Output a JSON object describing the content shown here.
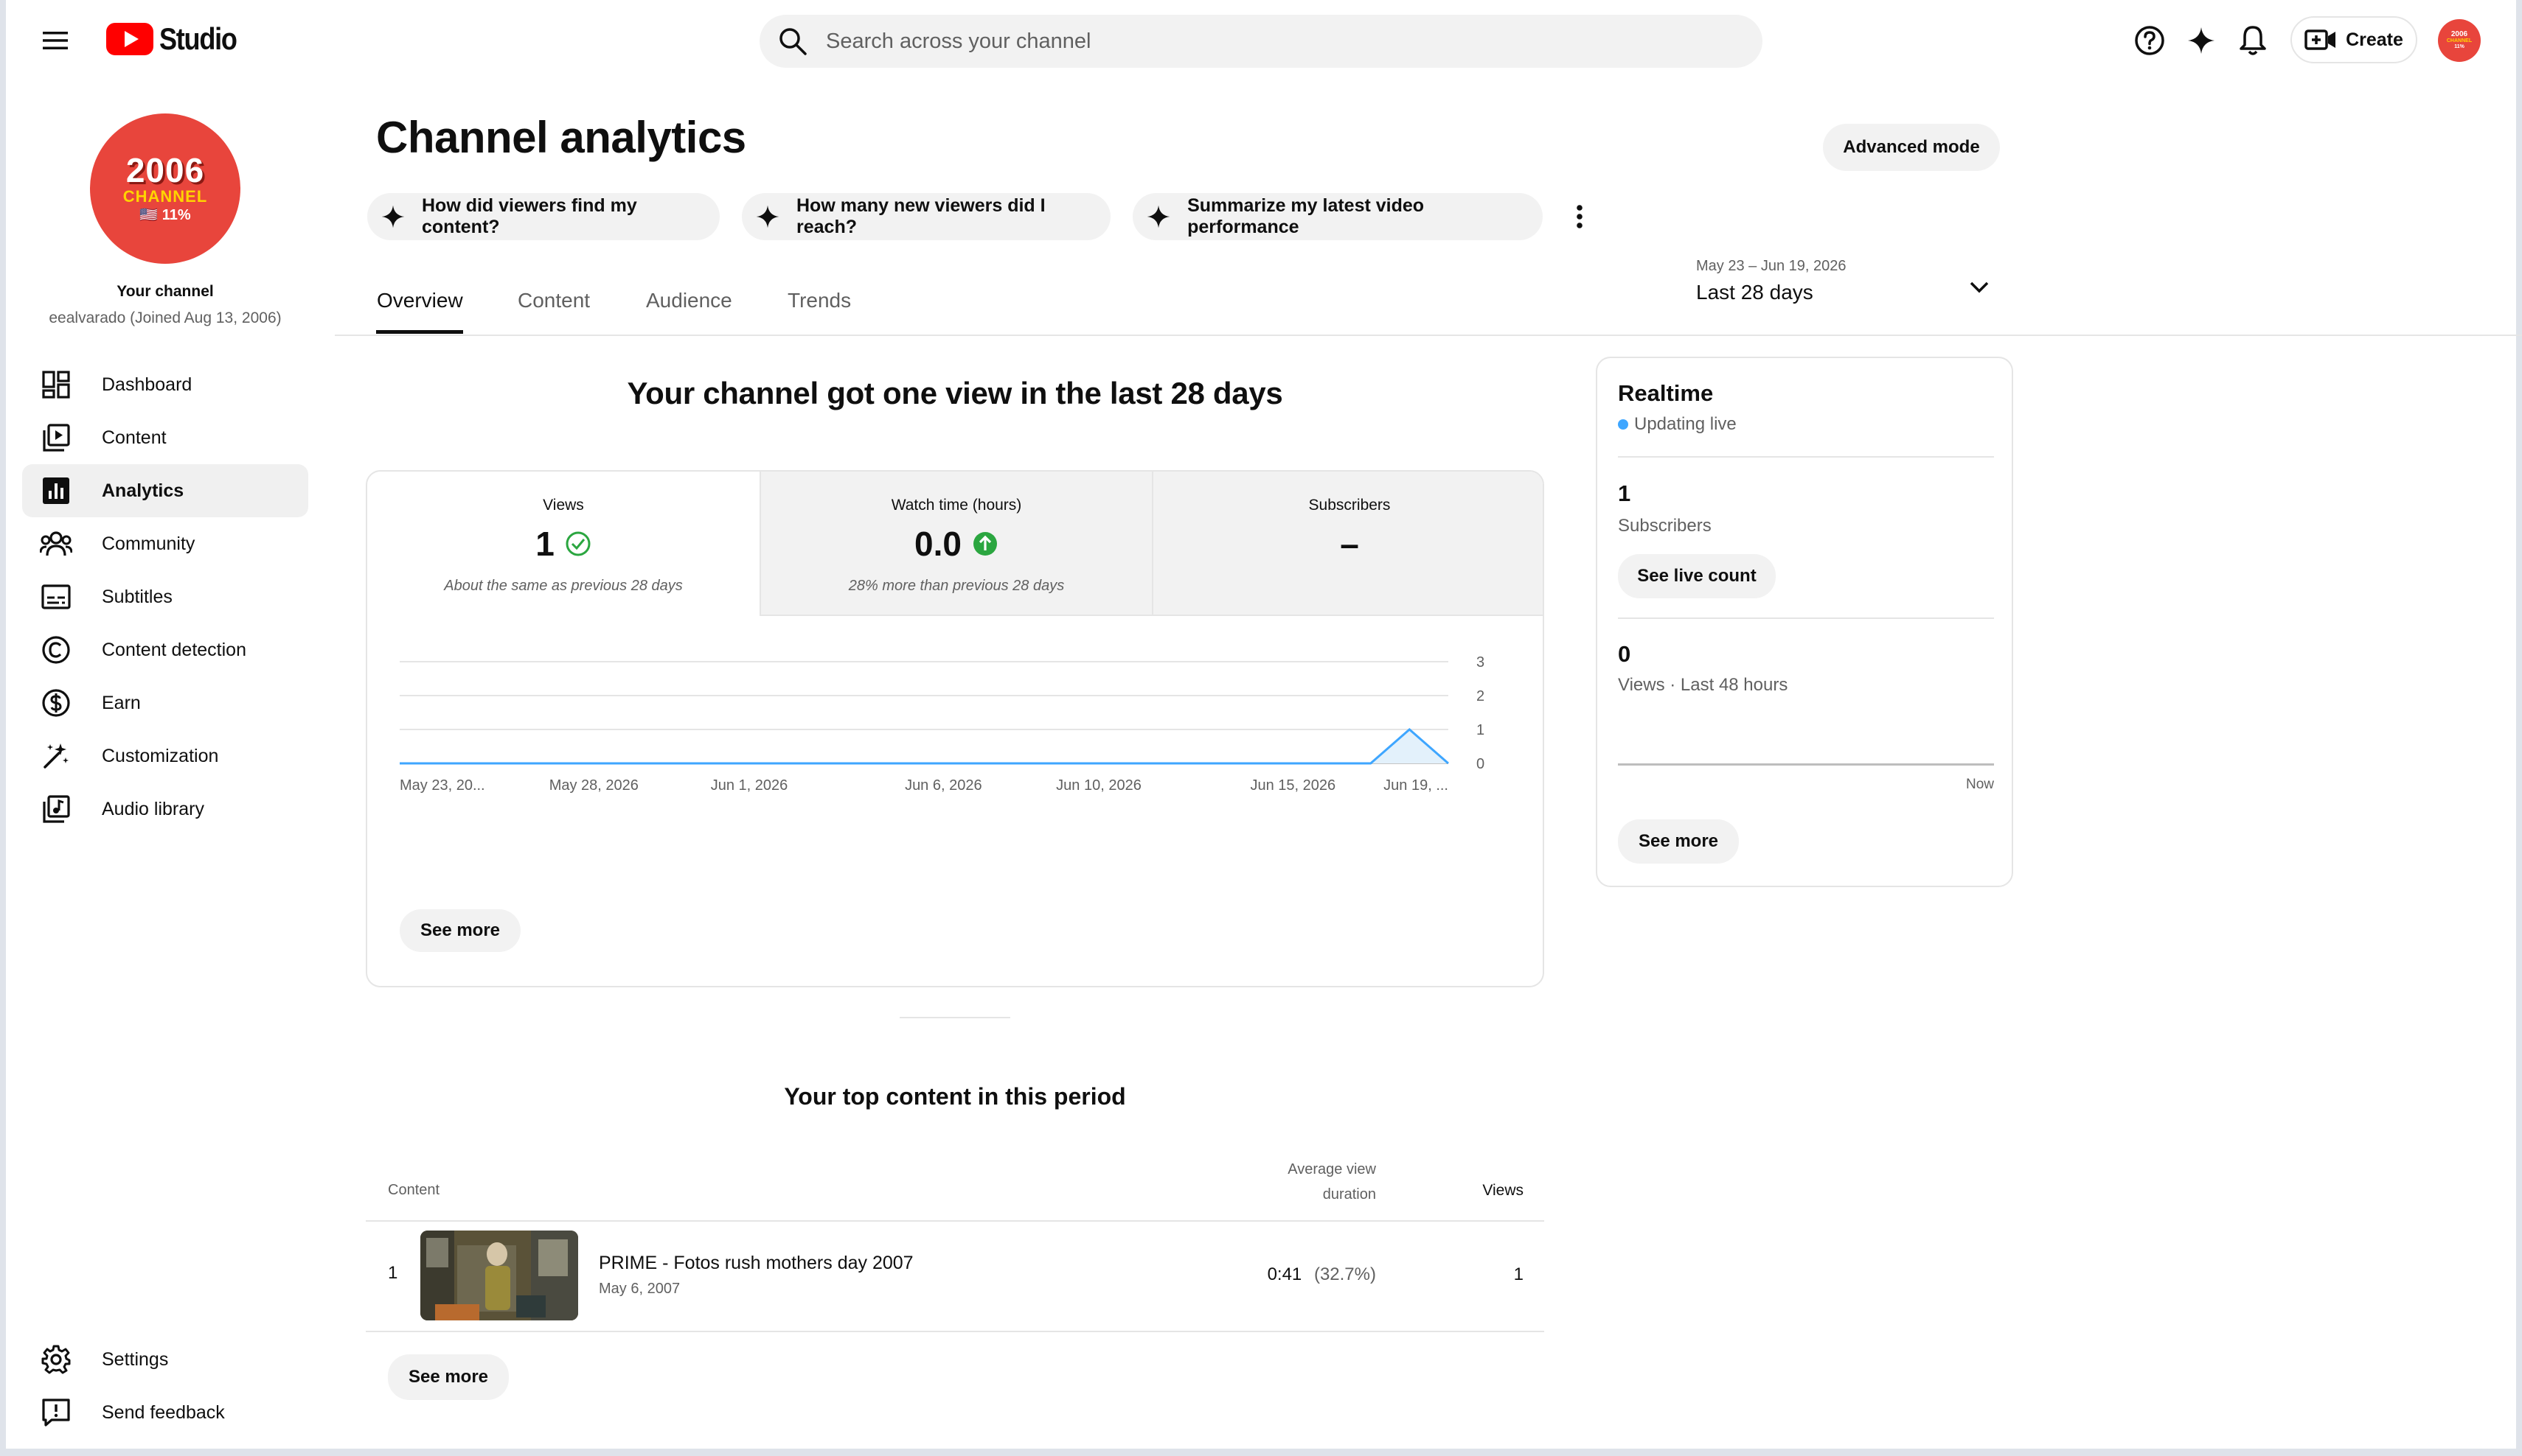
{
  "header": {
    "logo_text": "Studio",
    "search_placeholder": "Search across your channel",
    "create_label": "Create",
    "avatar_line1": "2006",
    "avatar_line2": "CHANNEL",
    "avatar_line3": "11%"
  },
  "sidebar": {
    "avatar_line1": "2006",
    "avatar_line2": "CHANNEL",
    "avatar_line3": "🇺🇸 11%",
    "channel_title": "Your channel",
    "channel_subtitle": "eealvarado (Joined Aug 13, 2006)",
    "items": [
      {
        "label": "Dashboard",
        "icon": "dashboard-icon"
      },
      {
        "label": "Content",
        "icon": "content-icon"
      },
      {
        "label": "Analytics",
        "icon": "analytics-icon",
        "active": true
      },
      {
        "label": "Community",
        "icon": "community-icon"
      },
      {
        "label": "Subtitles",
        "icon": "subtitles-icon"
      },
      {
        "label": "Content detection",
        "icon": "copyright-icon"
      },
      {
        "label": "Earn",
        "icon": "dollar-icon"
      },
      {
        "label": "Customization",
        "icon": "magic-wand-icon"
      },
      {
        "label": "Audio library",
        "icon": "audio-library-icon"
      }
    ],
    "bottom_items": [
      {
        "label": "Settings",
        "icon": "gear-icon"
      },
      {
        "label": "Send feedback",
        "icon": "feedback-icon"
      }
    ]
  },
  "page": {
    "title": "Channel analytics",
    "advanced_mode_label": "Advanced mode",
    "chips": [
      "How did viewers find my content?",
      "How many new viewers did I reach?",
      "Summarize my latest video performance"
    ],
    "tabs": [
      "Overview",
      "Content",
      "Audience",
      "Trends"
    ],
    "active_tab": "Overview",
    "date_range": "May 23 – Jun 19, 2026",
    "date_period": "Last 28 days"
  },
  "overview": {
    "headline": "Your channel got one view in the last 28 days",
    "metrics": [
      {
        "title": "Views",
        "value": "1",
        "note": "About the same as previous 28 days",
        "status": "same"
      },
      {
        "title": "Watch time (hours)",
        "value": "0.0",
        "note": "28% more than previous 28 days",
        "status": "up"
      },
      {
        "title": "Subscribers",
        "value": "–",
        "note": "",
        "status": "none"
      }
    ],
    "see_more_label": "See more"
  },
  "chart_data": {
    "type": "area",
    "series": [
      {
        "name": "Views",
        "values": [
          0,
          0,
          0,
          0,
          0,
          0,
          0,
          0,
          0,
          0,
          0,
          0,
          0,
          0,
          0,
          0,
          0,
          0,
          0,
          0,
          0,
          0,
          0,
          0,
          0,
          0,
          1,
          0
        ]
      }
    ],
    "x": [
      "May 23",
      "May 24",
      "May 25",
      "May 26",
      "May 27",
      "May 28",
      "May 29",
      "May 30",
      "May 31",
      "Jun 1",
      "Jun 2",
      "Jun 3",
      "Jun 4",
      "Jun 5",
      "Jun 6",
      "Jun 7",
      "Jun 8",
      "Jun 9",
      "Jun 10",
      "Jun 11",
      "Jun 12",
      "Jun 13",
      "Jun 14",
      "Jun 15",
      "Jun 16",
      "Jun 17",
      "Jun 18",
      "Jun 19"
    ],
    "x_tick_labels": [
      "May 23, 20...",
      "May 28, 2026",
      "Jun 1, 2026",
      "Jun 6, 2026",
      "Jun 10, 2026",
      "Jun 15, 2026",
      "Jun 19, ..."
    ],
    "x_tick_index": [
      0,
      5,
      9,
      14,
      18,
      23,
      27
    ],
    "y_ticks": [
      0,
      1,
      2,
      3
    ],
    "ylim": [
      0,
      3
    ],
    "line_color": "#3ea6ff",
    "fill_color": "#e3f1fb",
    "grid": true
  },
  "realtime": {
    "title": "Realtime",
    "status": "Updating live",
    "subscribers_value": "1",
    "subscribers_label": "Subscribers",
    "live_count_label": "See live count",
    "views_value": "0",
    "views_label": "Views · Last 48 hours",
    "now_label": "Now",
    "see_more_label": "See more"
  },
  "top_content": {
    "heading": "Your top content in this period",
    "col_content": "Content",
    "col_avd_line1": "Average view",
    "col_avd_line2": "duration",
    "col_views": "Views",
    "rows": [
      {
        "rank": "1",
        "title": "PRIME - Fotos rush mothers day 2007",
        "date": "May 6, 2007",
        "avd": "0:41",
        "avd_pct": "(32.7%)",
        "views": "1"
      }
    ],
    "see_more_label": "See more"
  },
  "colors": {
    "brand_red": "#ff0000",
    "accent_blue": "#3ea6ff",
    "success_green": "#2ba640",
    "chip_bg": "#f2f2f2"
  }
}
